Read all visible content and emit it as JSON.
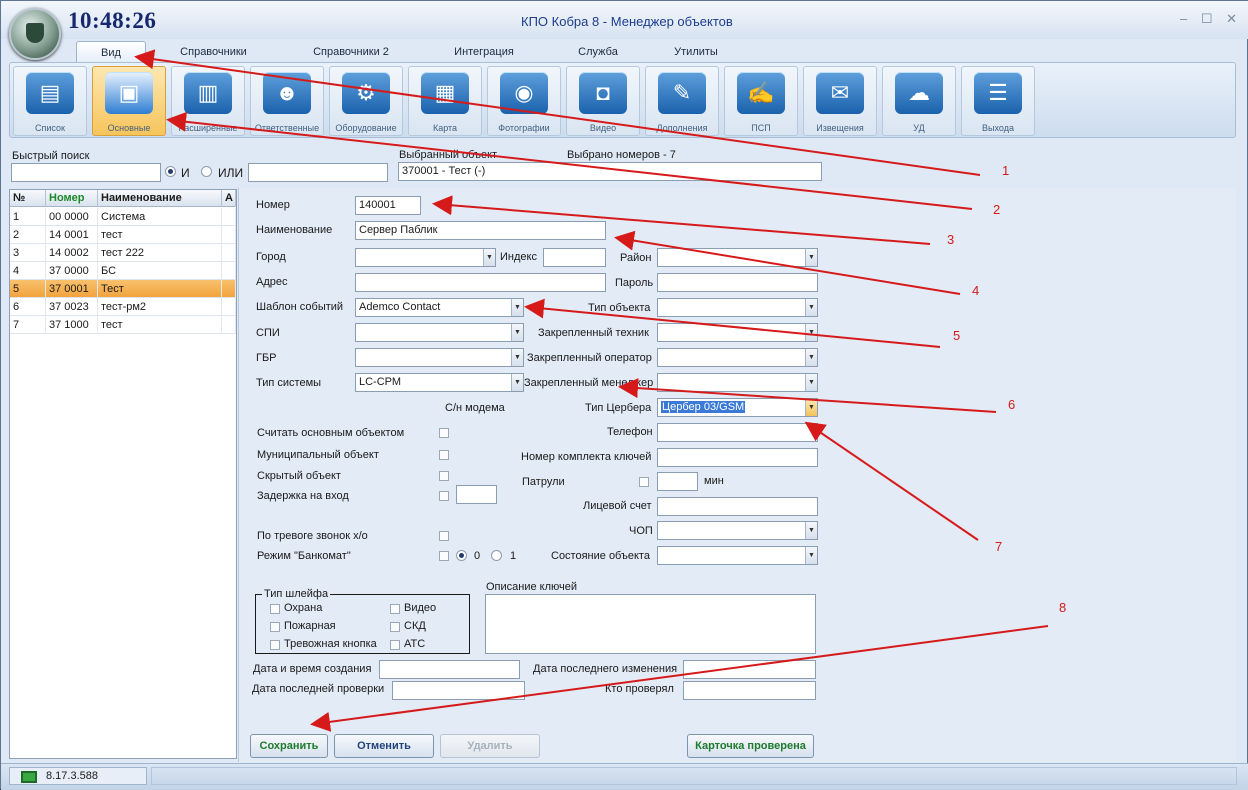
{
  "window": {
    "clock": "10:48:26",
    "title": "КПО Кобра 8 -   Менеджер объектов",
    "controls": [
      "–",
      "☐",
      "✕"
    ]
  },
  "tabs": [
    "Вид",
    "Справочники",
    "Справочники 2",
    "Интеграция",
    "Служба",
    "Утилиты"
  ],
  "ribbon": [
    {
      "label": "Список",
      "icon": "list-icon"
    },
    {
      "label": "Основные",
      "icon": "main-card-icon"
    },
    {
      "label": "Расширенные",
      "icon": "folder-icon"
    },
    {
      "label": "Ответственные",
      "icon": "people-icon"
    },
    {
      "label": "Оборудование",
      "icon": "equipment-icon"
    },
    {
      "label": "Карта",
      "icon": "map-icon"
    },
    {
      "label": "Фотографии",
      "icon": "camera-icon"
    },
    {
      "label": "Видео",
      "icon": "video-camera-icon"
    },
    {
      "label": "Дополнения",
      "icon": "notepad-icon"
    },
    {
      "label": "ПСП",
      "icon": "signature-icon"
    },
    {
      "label": "Извещения",
      "icon": "notification-phone-icon"
    },
    {
      "label": "УД",
      "icon": "cloud-sync-icon"
    },
    {
      "label": "Выхода",
      "icon": "sliders-icon"
    }
  ],
  "search": {
    "label": "Быстрый поиск",
    "value1": "",
    "and_label": "И",
    "or_label": "ИЛИ",
    "value2": "",
    "selected_object_label": "Выбранный объект",
    "selected_count_label": "Выбрано номеров -  7",
    "selected_object_value": "370001 - Тест (-)"
  },
  "grid": {
    "headers": [
      "№",
      "Номер",
      "Наименование",
      "А"
    ],
    "rows": [
      [
        "1",
        "00  0000",
        "Система"
      ],
      [
        "2",
        "14  0001",
        "тест"
      ],
      [
        "3",
        "14  0002",
        "тест 222"
      ],
      [
        "4",
        "37  0000",
        "БС"
      ],
      [
        "5",
        "37  0001",
        "Тест"
      ],
      [
        "6",
        "37  0023",
        "тест-рм2"
      ],
      [
        "7",
        "37  1000",
        "тест"
      ]
    ]
  },
  "form": {
    "number_label": "Номер",
    "number_value": "140001",
    "name_label": "Наименование",
    "name_value": "Сервер Паблик",
    "city_label": "Город",
    "city_value": "",
    "index_label": "Индекс",
    "index_value": "",
    "district_label": "Район",
    "district_value": "",
    "address_label": "Адрес",
    "address_value": "",
    "password_label": "Пароль",
    "password_value": "",
    "events_template_label": "Шаблон событий",
    "events_template_value": "Ademco Contact",
    "object_type_label": "Тип объекта",
    "object_type_value": "",
    "spi_label": "СПИ",
    "spi_value": "",
    "tech_label": "Закрепленный техник",
    "tech_value": "",
    "gbr_label": "ГБР",
    "gbr_value": "",
    "operator_label": "Закрепленный оператор",
    "operator_value": "",
    "system_type_label": "Тип системы",
    "system_type_value": "LC-СРМ",
    "manager_label": "Закрепленный менеджер",
    "manager_value": "",
    "modem_sn_label": "С/н модема",
    "cerber_type_label": "Тип Цербера",
    "cerber_type_value": "Цербер 03/GSM",
    "main_object_label": "Считать основным объектом",
    "phone_label": "Телефон",
    "phone_value": "",
    "municipal_label": "Муниципальный объект",
    "keyset_label": "Номер комплекта ключей",
    "keyset_value": "",
    "hidden_label": "Скрытый объект",
    "delay_label": "Задержка на вход",
    "delay_value": "",
    "patrols_label": "Патрули",
    "patrols_value": "",
    "min_label": "мин",
    "account_label": "Лицевой счет",
    "account_value": "",
    "alarm_call_label": "По тревоге звонок х/о",
    "chop_label": "ЧОП",
    "chop_value": "",
    "atm_label": "Режим \"Банкомат\"",
    "atm_opt0": "0",
    "atm_opt1": "1",
    "state_label": "Состояние объекта",
    "state_value": "",
    "loop_type_label": "Тип шлейфа",
    "loop_types": [
      "Охрана",
      "Пожарная",
      "Тревожная кнопка",
      "Видео",
      "СКД",
      "АТС"
    ],
    "keys_desc_label": "Описание ключей",
    "keys_desc_value": "",
    "created_label": "Дата и время создания",
    "created_value": "",
    "modified_label": "Дата последнего изменения",
    "modified_value": "",
    "last_check_label": "Дата последней проверки",
    "last_check_value": "",
    "checked_by_label": "Кто проверял",
    "checked_by_value": ""
  },
  "buttons": {
    "save": "Сохранить",
    "cancel": "Отменить",
    "delete": "Удалить",
    "card_checked": "Карточка проверена"
  },
  "status": {
    "version": "8.17.3.588"
  },
  "annotations": [
    "1",
    "2",
    "3",
    "4",
    "5",
    "6",
    "7",
    "8"
  ],
  "colors": {
    "annotation": "#d61a1a",
    "active_row": "#f2a33d",
    "accent_blue": "#1d3d8b"
  }
}
